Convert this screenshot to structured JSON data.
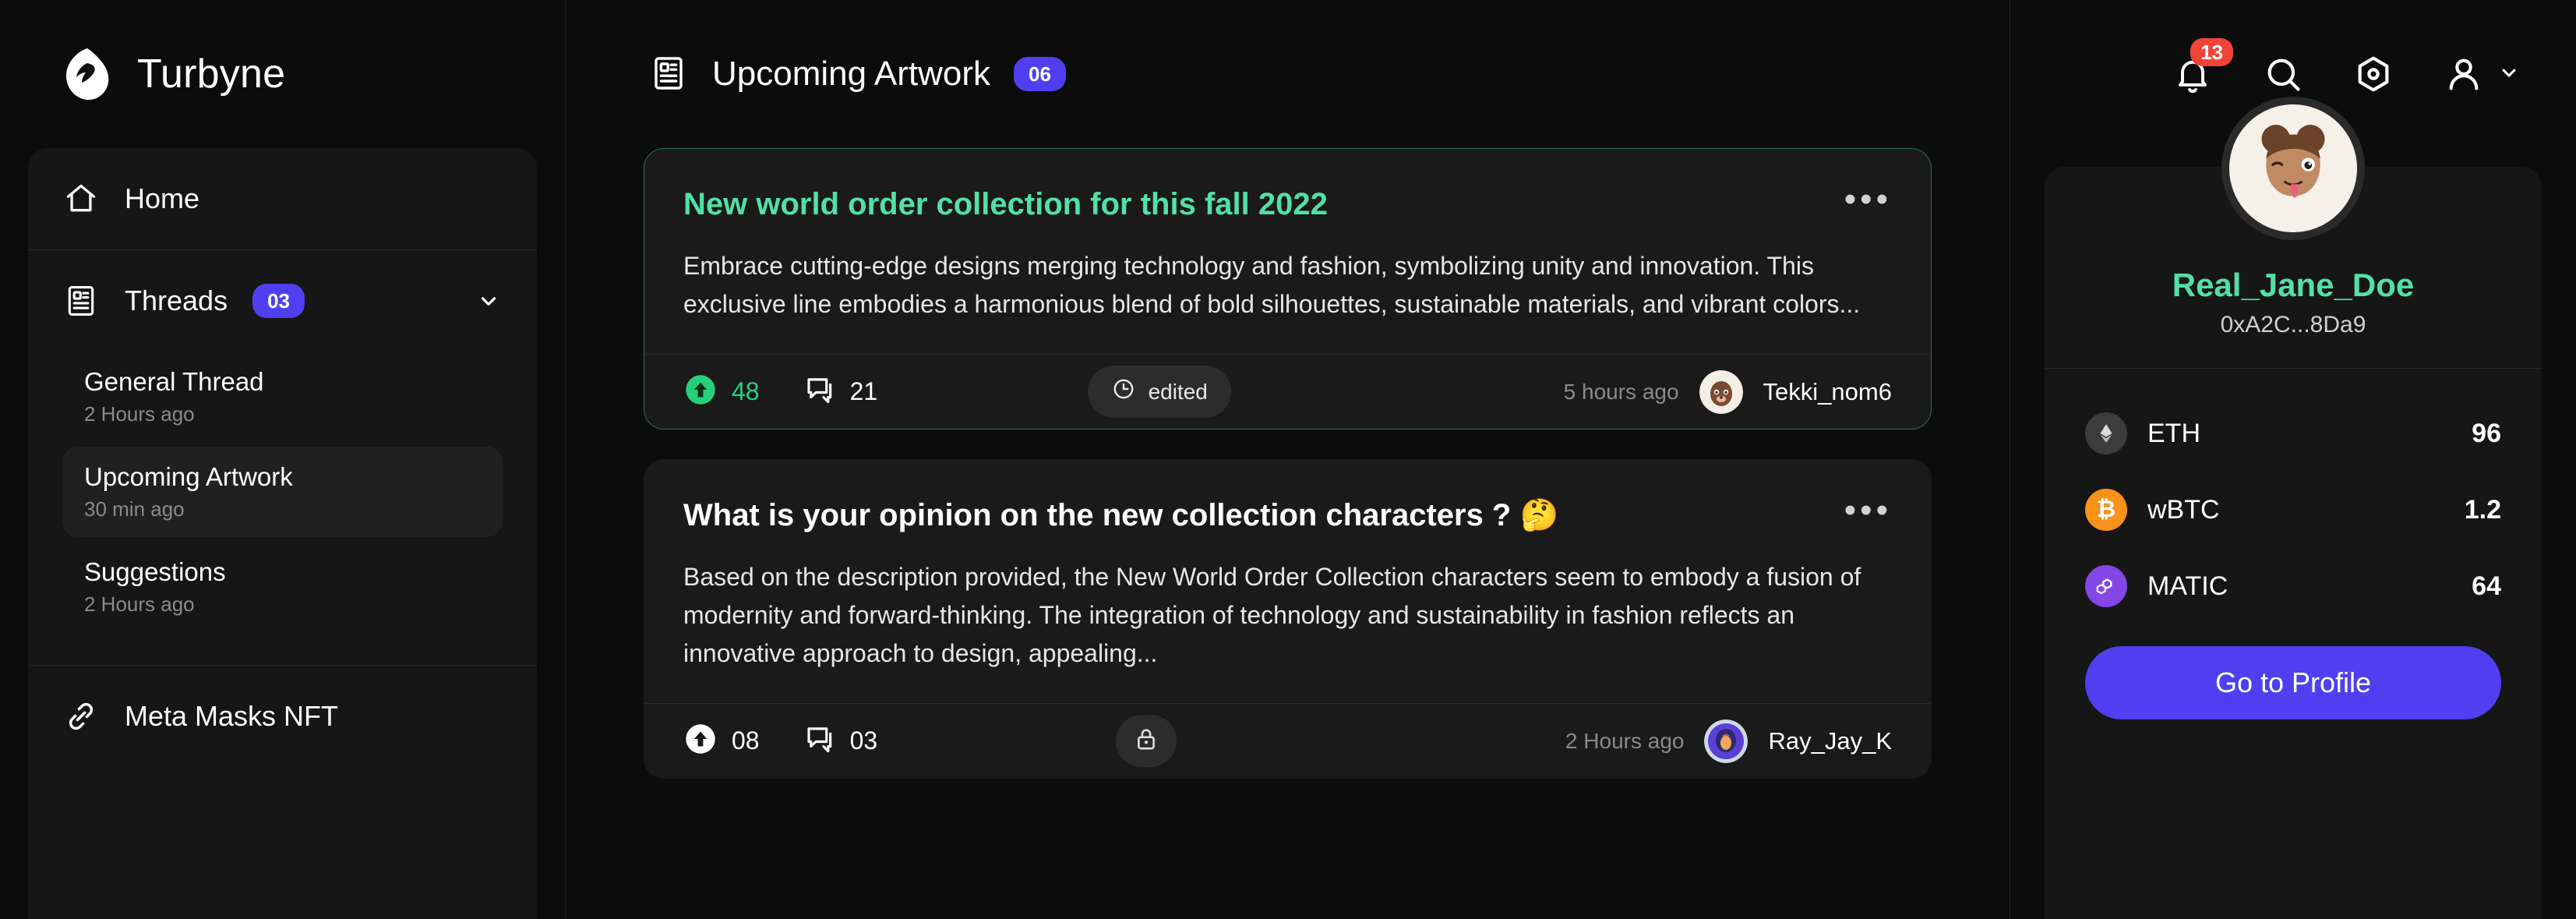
{
  "brand": {
    "name": "Turbyne",
    "logo_icon": "turbyne-logo-icon"
  },
  "sidebar": {
    "home": {
      "label": "Home",
      "icon": "home-icon"
    },
    "threads": {
      "label": "Threads",
      "count": "03",
      "icon": "threads-icon",
      "chevron_icon": "chevron-down-icon"
    },
    "thread_items": [
      {
        "title": "General Thread",
        "time": "2 Hours ago",
        "active": false
      },
      {
        "title": "Upcoming Artwork",
        "time": "30 min ago",
        "active": true
      },
      {
        "title": "Suggestions",
        "time": "2 Hours ago",
        "active": false
      }
    ],
    "nft": {
      "label": "Meta Masks NFT",
      "icon": "link-icon"
    },
    "scrollbar_color": "#52E0A5"
  },
  "header": {
    "title": "Upcoming Artwork",
    "title_icon": "threads-icon",
    "count": "06",
    "count_color": "#4F3FF0"
  },
  "topbar": {
    "notification_icon": "bell-icon",
    "notification_count": "13",
    "notification_badge_color": "#F04438",
    "search_icon": "search-icon",
    "settings_icon": "gear-hexagon-icon",
    "account_icon": "user-icon",
    "account_chevron_icon": "chevron-down-icon"
  },
  "feed": {
    "posts": [
      {
        "title": "New world order collection for this fall 2022",
        "title_color": "#52E0A5",
        "highlighted": true,
        "body": "Embrace cutting-edge designs merging technology and fashion, symbolizing unity and innovation. This exclusive line embodies a harmonious blend of bold silhouettes, sustainable materials, and vibrant colors...",
        "upvotes": "48",
        "upvote_style": "filled-green",
        "comments": "21",
        "status_label": "edited",
        "status_icon": "clock-icon",
        "time": "5 hours ago",
        "user": "Tekki_nom6",
        "menu_icon": "more-options-icon"
      },
      {
        "title": "What is your opinion on the new collection characters ? 🤔",
        "title_color": "#ffffff",
        "highlighted": false,
        "body": "Based on the description provided, the New World Order Collection characters seem to embody a fusion of modernity and forward-thinking. The integration of technology and sustainability in fashion reflects an innovative approach to design, appealing...",
        "upvotes": "08",
        "upvote_style": "filled-white",
        "comments": "03",
        "status_label": "",
        "status_icon": "lock-icon",
        "time": "2 Hours ago",
        "user": "Ray_Jay_K",
        "menu_icon": "more-options-icon"
      }
    ]
  },
  "profile": {
    "avatar_icon": "memoji-avatar",
    "name": "Real_Jane_Doe",
    "name_color": "#52E0A5",
    "address": "0xA2C...8Da9",
    "coins": [
      {
        "symbol": "ETH",
        "value": "96",
        "icon": "ethereum-icon",
        "color": "#3c3c3c"
      },
      {
        "symbol": "wBTC",
        "value": "1.2",
        "icon": "bitcoin-icon",
        "color": "#F7931A"
      },
      {
        "symbol": "MATIC",
        "value": "64",
        "icon": "polygon-icon",
        "color": "#8247E5"
      }
    ],
    "cta_label": "Go to Profile",
    "cta_color": "#4F3FF0"
  }
}
